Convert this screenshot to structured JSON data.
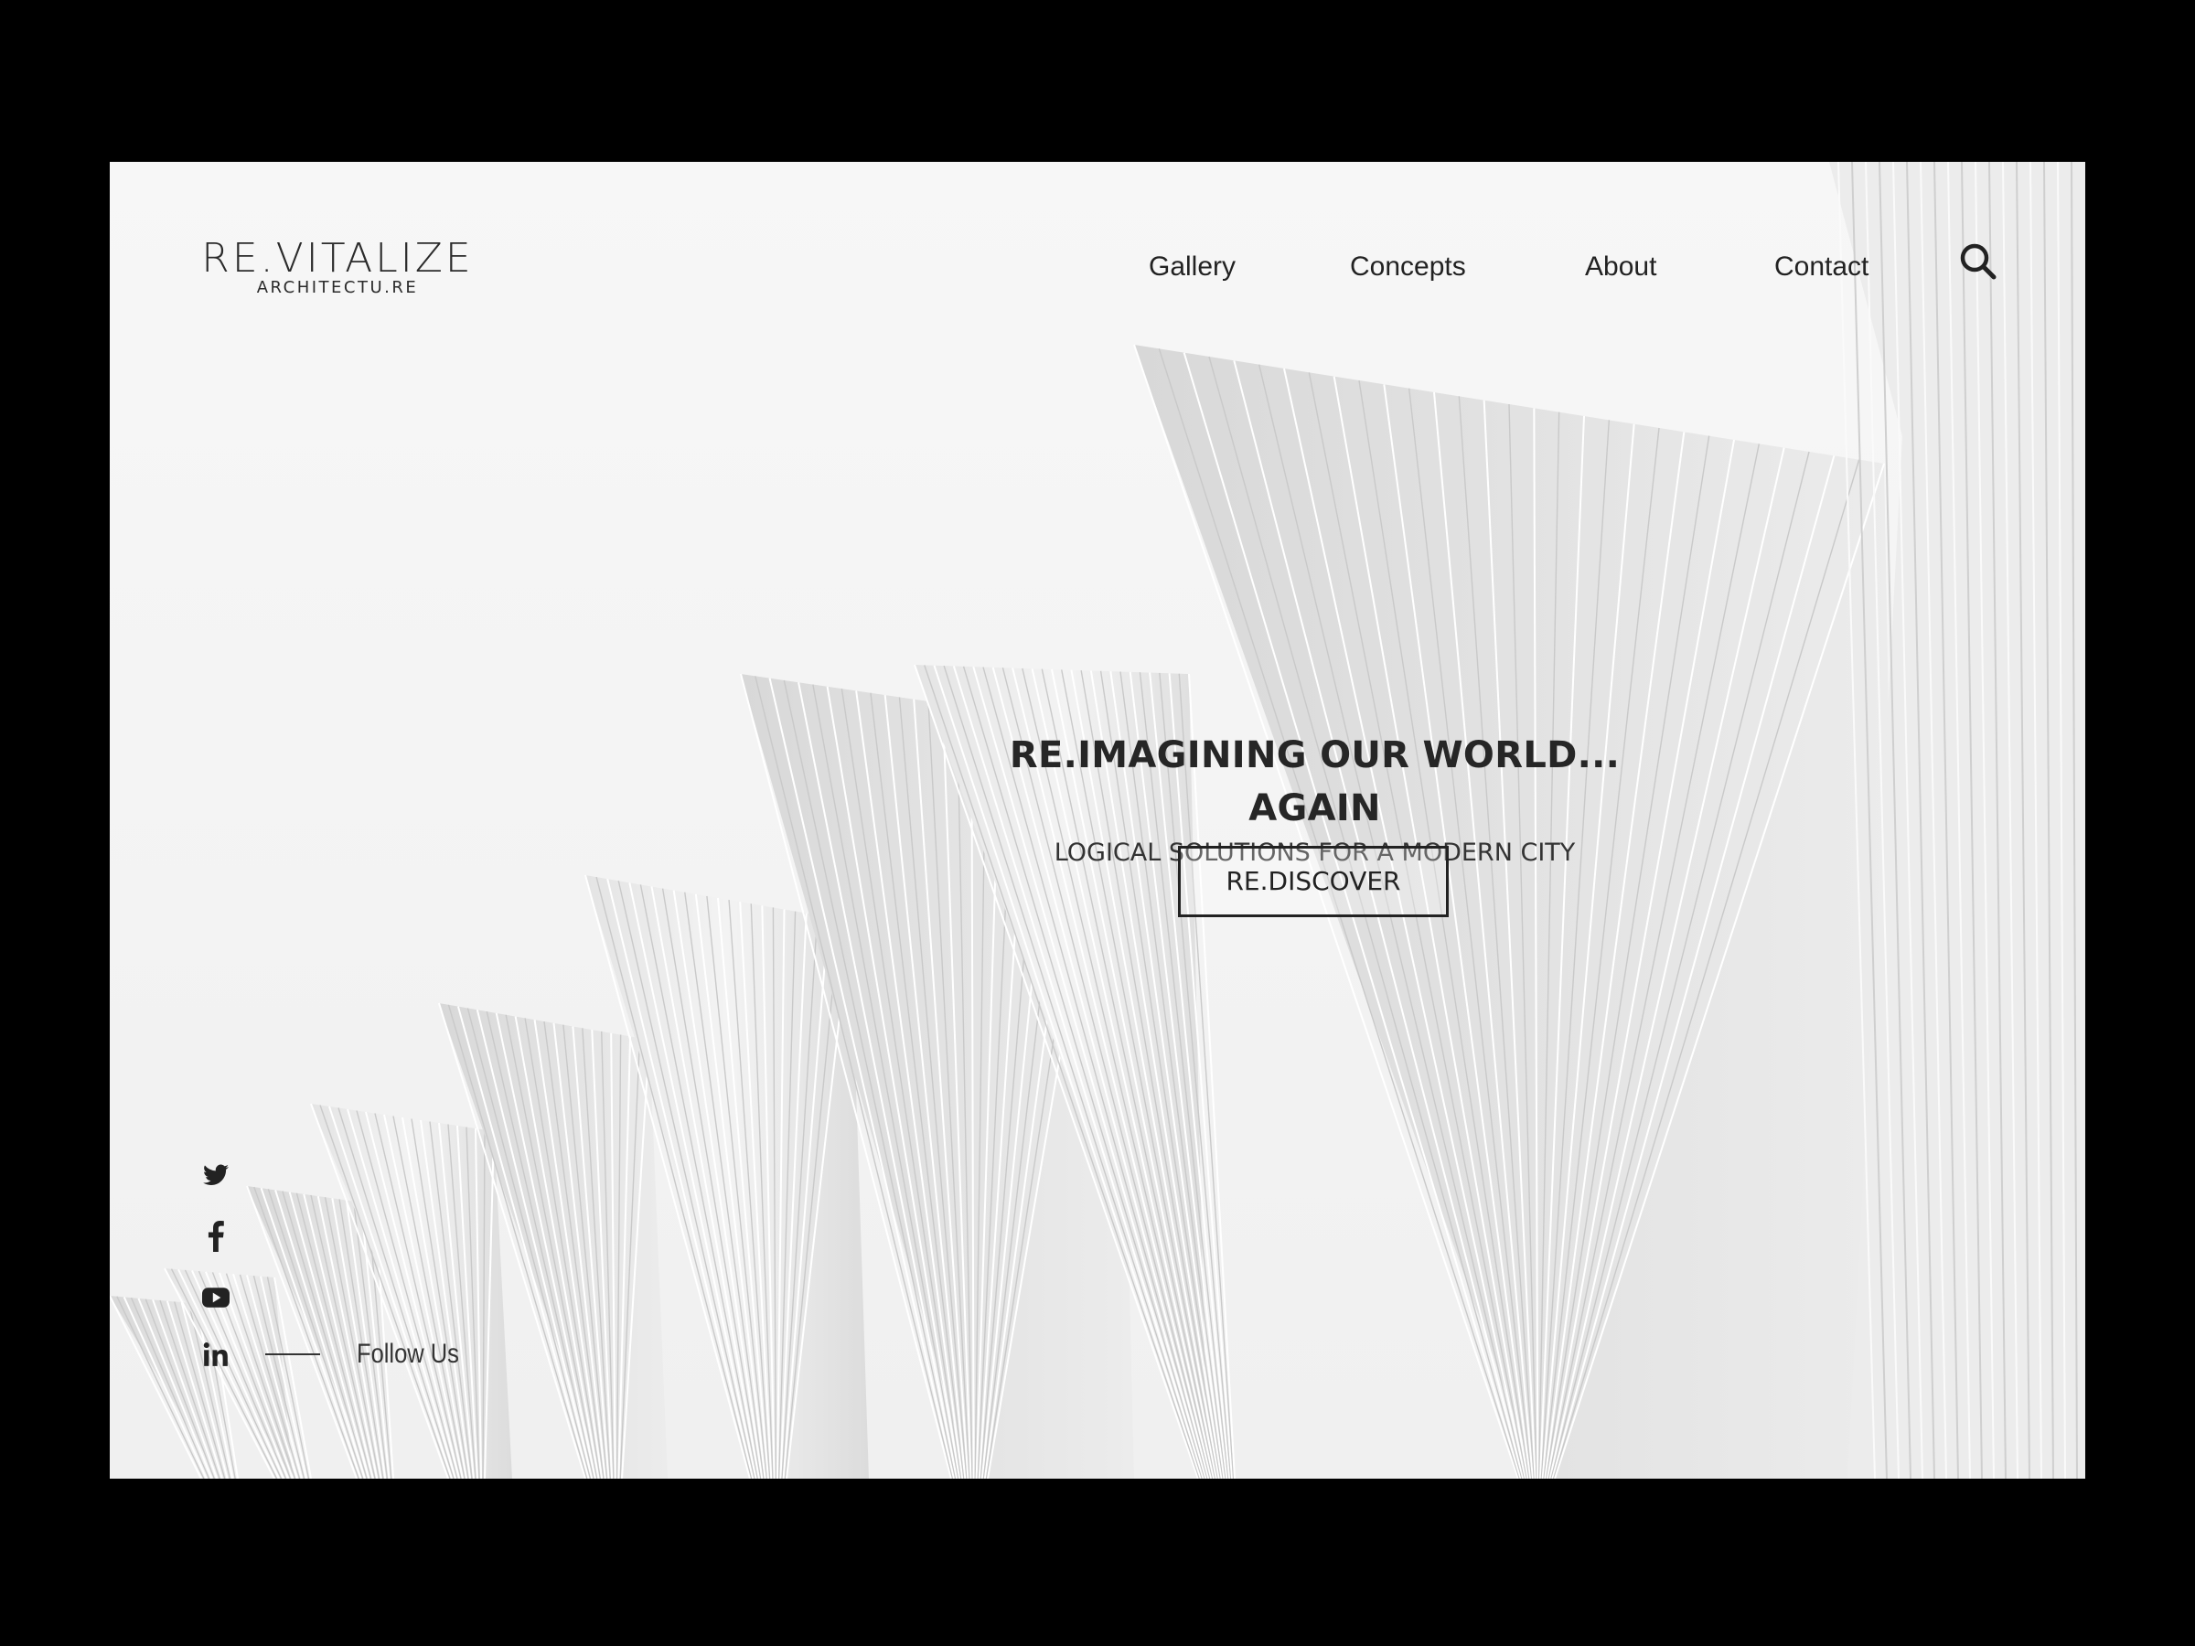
{
  "brand": {
    "name": "RE.VITALIZE",
    "tagline": "ARCHITECTU.RE"
  },
  "nav": {
    "items": [
      "Gallery",
      "Concepts",
      "About",
      "Contact"
    ],
    "search_icon": "search-icon"
  },
  "hero": {
    "headline": "RE.IMAGINING OUR WORLD... AGAIN",
    "subheadline": "LOGICAL SOLUTIONS FOR A MODERN CITY",
    "cta_label": "RE.DISCOVER"
  },
  "social": {
    "icons": [
      "twitter-icon",
      "facebook-icon",
      "youtube-icon",
      "linkedin-icon"
    ],
    "follow_label": "Follow Us"
  },
  "colors": {
    "text": "#222222",
    "background": "#f6f6f6",
    "frame": "#000000"
  }
}
